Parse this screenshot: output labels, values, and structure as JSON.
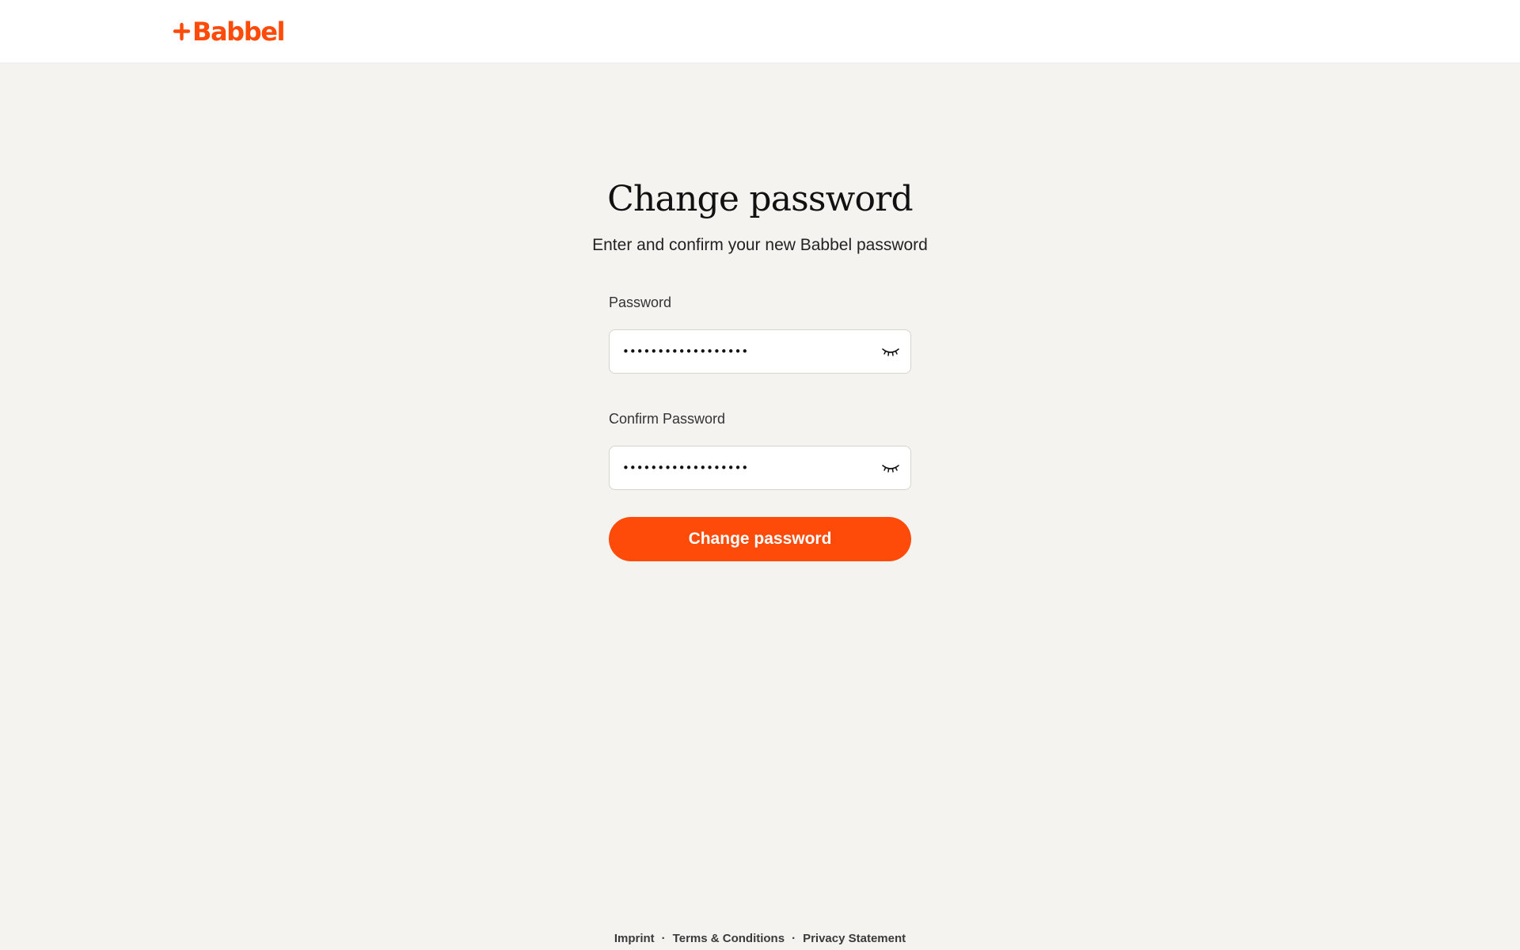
{
  "brand": {
    "name": "Babbel",
    "accent_color": "#ff4b0a",
    "logo_icon": "plus-logo-icon"
  },
  "page": {
    "title": "Change password",
    "subtitle": "Enter and confirm your new Babbel password"
  },
  "form": {
    "password": {
      "label": "Password",
      "value": "••••••••••••••••••",
      "toggle_icon": "eye-closed-icon"
    },
    "confirm_password": {
      "label": "Confirm Password",
      "value": "••••••••••••••••••",
      "toggle_icon": "eye-closed-icon"
    },
    "submit_label": "Change password"
  },
  "footer": {
    "links": [
      "Imprint",
      "Terms & Conditions",
      "Privacy Statement"
    ],
    "separator": "·"
  }
}
